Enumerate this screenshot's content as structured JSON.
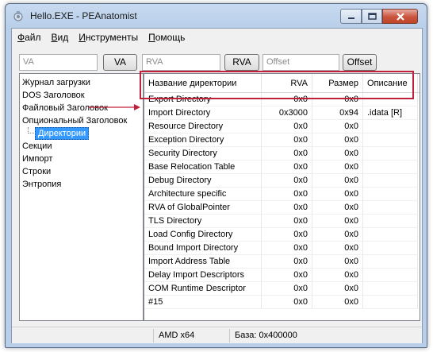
{
  "window": {
    "title": "Hello.EXE - PEAnatomist"
  },
  "menu": {
    "items": [
      {
        "underline": "Ф",
        "rest": "айл"
      },
      {
        "underline": "В",
        "rest": "ид"
      },
      {
        "underline": "И",
        "rest": "нструменты"
      },
      {
        "underline": "П",
        "rest": "омощь"
      }
    ]
  },
  "toolbar": {
    "va_placeholder": "VA",
    "va_button": "VA",
    "rva_placeholder": "RVA",
    "rva_button": "RVA",
    "offset_placeholder": "Offset",
    "offset_button": "Offset"
  },
  "tree": {
    "items": [
      "Журнал загрузки",
      "DOS Заголовок",
      "Файловый Заголовок",
      "Опциональный Заголовок",
      "Директории",
      "Секции",
      "Импорт",
      "Строки",
      "Энтропия"
    ],
    "selected": "Директории"
  },
  "grid": {
    "headers": {
      "name": "Название директории",
      "rva": "RVA",
      "size": "Размер",
      "desc": "Описание"
    },
    "rows": [
      {
        "name": "Export Directory",
        "rva": "0x0",
        "size": "0x0",
        "desc": ""
      },
      {
        "name": "Import Directory",
        "rva": "0x3000",
        "size": "0x94",
        "desc": ".idata [R]"
      },
      {
        "name": "Resource Directory",
        "rva": "0x0",
        "size": "0x0",
        "desc": ""
      },
      {
        "name": "Exception Directory",
        "rva": "0x0",
        "size": "0x0",
        "desc": ""
      },
      {
        "name": "Security Directory",
        "rva": "0x0",
        "size": "0x0",
        "desc": ""
      },
      {
        "name": "Base Relocation Table",
        "rva": "0x0",
        "size": "0x0",
        "desc": ""
      },
      {
        "name": "Debug Directory",
        "rva": "0x0",
        "size": "0x0",
        "desc": ""
      },
      {
        "name": "Architecture specific",
        "rva": "0x0",
        "size": "0x0",
        "desc": ""
      },
      {
        "name": "RVA of GlobalPointer",
        "rva": "0x0",
        "size": "0x0",
        "desc": ""
      },
      {
        "name": "TLS Directory",
        "rva": "0x0",
        "size": "0x0",
        "desc": ""
      },
      {
        "name": "Load Config Directory",
        "rva": "0x0",
        "size": "0x0",
        "desc": ""
      },
      {
        "name": "Bound Import Directory",
        "rva": "0x0",
        "size": "0x0",
        "desc": ""
      },
      {
        "name": "Import Address Table",
        "rva": "0x0",
        "size": "0x0",
        "desc": ""
      },
      {
        "name": "Delay Import Descriptors",
        "rva": "0x0",
        "size": "0x0",
        "desc": ""
      },
      {
        "name": "COM Runtime Descriptor",
        "rva": "0x0",
        "size": "0x0",
        "desc": ""
      },
      {
        "name": "#15",
        "rva": "0x0",
        "size": "0x0",
        "desc": ""
      }
    ]
  },
  "status": {
    "arch": "AMD x64",
    "base": "База: 0x400000"
  },
  "colors": {
    "highlight": "#c0203a",
    "selection": "#3399ff"
  }
}
